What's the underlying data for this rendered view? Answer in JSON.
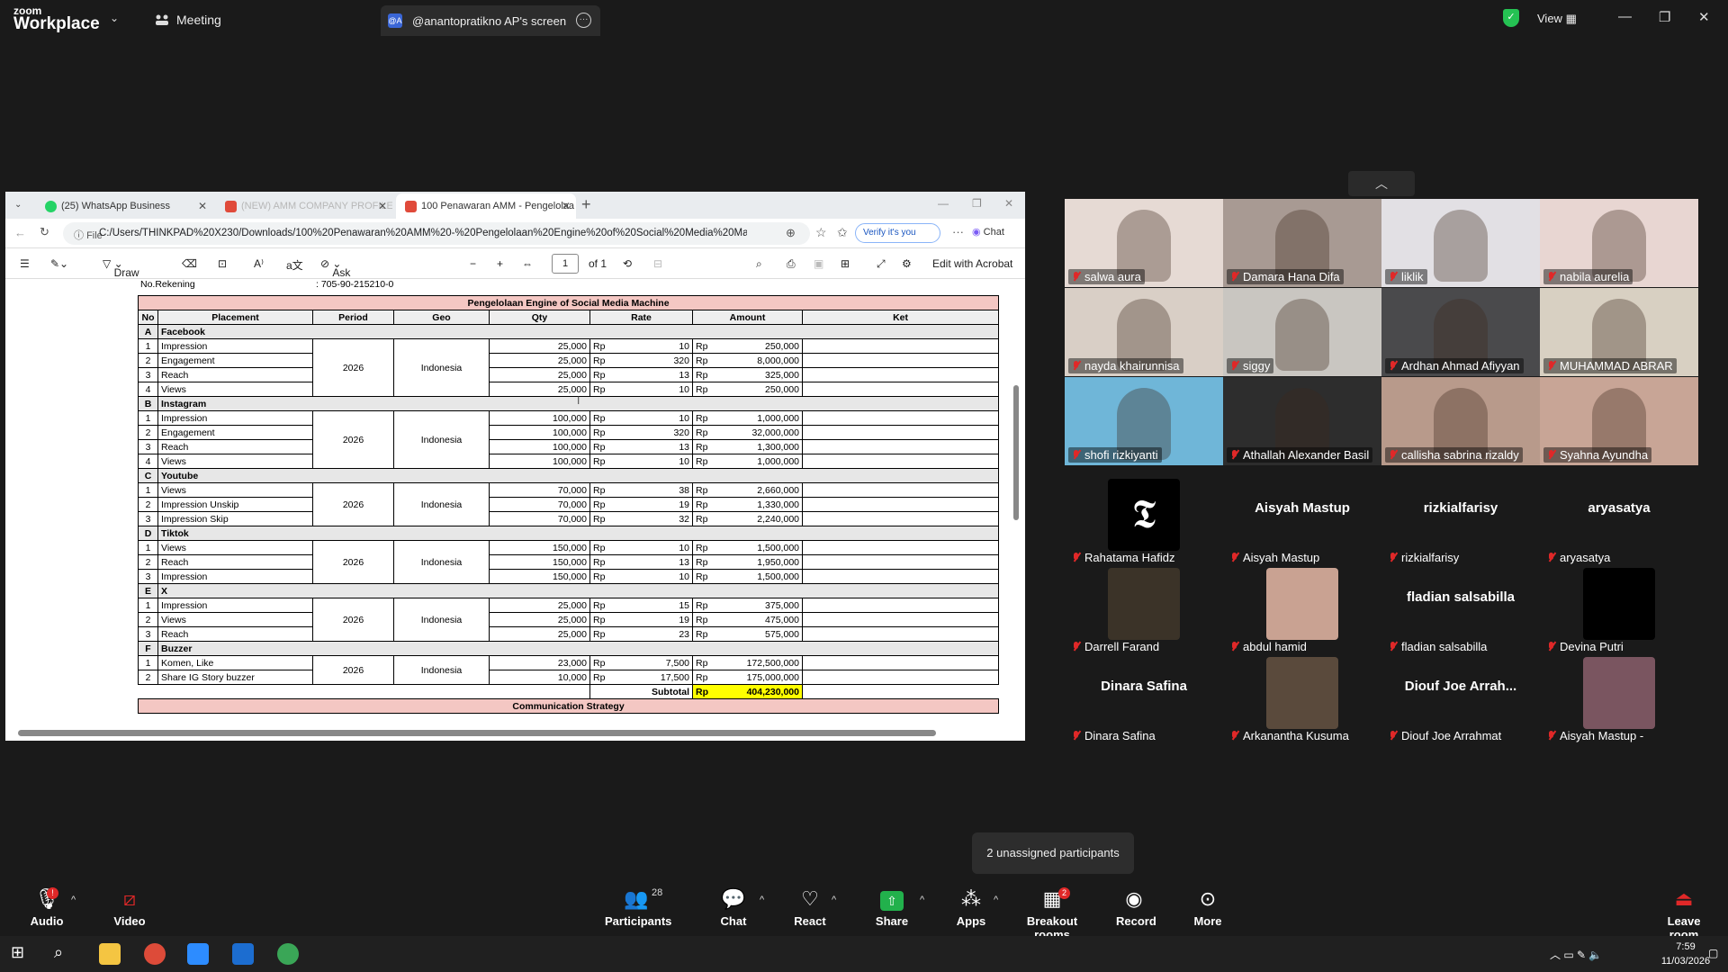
{
  "zoom": {
    "logo_top": "zoom",
    "logo_bottom": "Workplace",
    "meeting_label": "Meeting",
    "screen_tab_avatar": "@A",
    "screen_tab_label": "@anantopratikno AP's screen",
    "view_label": "View",
    "unassigned": "2 unassigned participants",
    "toolbar": {
      "audio": "Audio",
      "video": "Video",
      "participants": "Participants",
      "participants_count": "28",
      "chat": "Chat",
      "react": "React",
      "share": "Share",
      "apps": "Apps",
      "breakout": "Breakout rooms",
      "breakout_badge": "2",
      "record": "Record",
      "more": "More",
      "leave": "Leave room"
    }
  },
  "browser": {
    "tabs": [
      {
        "label": "(25) WhatsApp Business",
        "color": "#25d366"
      },
      {
        "label": "(NEW) AMM COMPANY PROFILE.p",
        "color": "#e04a3a"
      },
      {
        "label": "100 Penawaran AMM - Pengelolaa",
        "color": "#e04a3a"
      }
    ],
    "url_prefix": "File",
    "url": "C:/Users/THINKPAD%20X230/Downloads/100%20Penawaran%20AMM%20-%20Pengelolaan%20Engine%20of%20Social%20Media%20Machine...",
    "verify": "Verify it's you",
    "chat": "Chat",
    "pdf": {
      "draw": "Draw",
      "ask": "Ask Copilot",
      "page": "1",
      "of": "of 1",
      "edit": "Edit with Acrobat"
    }
  },
  "document": {
    "rekening_label": "No.Rekening",
    "rekening_value": ": 705-90-215210-0",
    "title": "Pengelolaan Engine of Social Media Machine",
    "headers": [
      "No",
      "Placement",
      "Period",
      "Geo",
      "Qty",
      "Rate",
      "Amount",
      "Ket"
    ],
    "groups": [
      {
        "code": "A",
        "name": "Facebook",
        "period": "2026",
        "geo": "Indonesia",
        "rows": [
          {
            "no": "1",
            "item": "Impression",
            "qty": "25,000",
            "cur": "Rp",
            "rate": "10",
            "acur": "Rp",
            "amount": "250,000"
          },
          {
            "no": "2",
            "item": "Engagement",
            "qty": "25,000",
            "cur": "Rp",
            "rate": "320",
            "acur": "Rp",
            "amount": "8,000,000"
          },
          {
            "no": "3",
            "item": "Reach",
            "qty": "25,000",
            "cur": "Rp",
            "rate": "13",
            "acur": "Rp",
            "amount": "325,000"
          },
          {
            "no": "4",
            "item": "Views",
            "qty": "25,000",
            "cur": "Rp",
            "rate": "10",
            "acur": "Rp",
            "amount": "250,000"
          }
        ]
      },
      {
        "code": "B",
        "name": "Instagram",
        "period": "2026",
        "geo": "Indonesia",
        "rows": [
          {
            "no": "1",
            "item": "Impression",
            "qty": "100,000",
            "cur": "Rp",
            "rate": "10",
            "acur": "Rp",
            "amount": "1,000,000"
          },
          {
            "no": "2",
            "item": "Engagement",
            "qty": "100,000",
            "cur": "Rp",
            "rate": "320",
            "acur": "Rp",
            "amount": "32,000,000"
          },
          {
            "no": "3",
            "item": "Reach",
            "qty": "100,000",
            "cur": "Rp",
            "rate": "13",
            "acur": "Rp",
            "amount": "1,300,000"
          },
          {
            "no": "4",
            "item": "Views",
            "qty": "100,000",
            "cur": "Rp",
            "rate": "10",
            "acur": "Rp",
            "amount": "1,000,000"
          }
        ]
      },
      {
        "code": "C",
        "name": "Youtube",
        "period": "2026",
        "geo": "Indonesia",
        "rows": [
          {
            "no": "1",
            "item": "Views",
            "qty": "70,000",
            "cur": "Rp",
            "rate": "38",
            "acur": "Rp",
            "amount": "2,660,000"
          },
          {
            "no": "2",
            "item": "Impression Unskip",
            "qty": "70,000",
            "cur": "Rp",
            "rate": "19",
            "acur": "Rp",
            "amount": "1,330,000"
          },
          {
            "no": "3",
            "item": "Impression Skip",
            "qty": "70,000",
            "cur": "Rp",
            "rate": "32",
            "acur": "Rp",
            "amount": "2,240,000"
          }
        ]
      },
      {
        "code": "D",
        "name": "Tiktok",
        "period": "2026",
        "geo": "Indonesia",
        "rows": [
          {
            "no": "1",
            "item": "Views",
            "qty": "150,000",
            "cur": "Rp",
            "rate": "10",
            "acur": "Rp",
            "amount": "1,500,000"
          },
          {
            "no": "2",
            "item": "Reach",
            "qty": "150,000",
            "cur": "Rp",
            "rate": "13",
            "acur": "Rp",
            "amount": "1,950,000"
          },
          {
            "no": "3",
            "item": "Impression",
            "qty": "150,000",
            "cur": "Rp",
            "rate": "10",
            "acur": "Rp",
            "amount": "1,500,000"
          }
        ]
      },
      {
        "code": "E",
        "name": "X",
        "period": "2026",
        "geo": "Indonesia",
        "rows": [
          {
            "no": "1",
            "item": "Impression",
            "qty": "25,000",
            "cur": "Rp",
            "rate": "15",
            "acur": "Rp",
            "amount": "375,000"
          },
          {
            "no": "2",
            "item": "Views",
            "qty": "25,000",
            "cur": "Rp",
            "rate": "19",
            "acur": "Rp",
            "amount": "475,000"
          },
          {
            "no": "3",
            "item": "Reach",
            "qty": "25,000",
            "cur": "Rp",
            "rate": "23",
            "acur": "Rp",
            "amount": "575,000"
          }
        ]
      },
      {
        "code": "F",
        "name": "Buzzer",
        "period": "2026",
        "geo": "Indonesia",
        "rows": [
          {
            "no": "1",
            "item": "Komen, Like",
            "qty": "23,000",
            "cur": "Rp",
            "rate": "7,500",
            "acur": "Rp",
            "amount": "172,500,000"
          },
          {
            "no": "2",
            "item": "Share IG Story buzzer",
            "qty": "10,000",
            "cur": "Rp",
            "rate": "17,500",
            "acur": "Rp",
            "amount": "175,000,000"
          }
        ]
      }
    ],
    "subtotal_label": "Subtotal",
    "subtotal_cur": "Rp",
    "subtotal_value": "404,230,000",
    "next_section": "Communication Strategy"
  },
  "gallery": {
    "video_tiles": [
      {
        "name": "salwa aura",
        "bg": "#e6dad4"
      },
      {
        "name": "Damara Hana Difa",
        "bg": "#a89a93"
      },
      {
        "name": "liklik",
        "bg": "#e2e0e4"
      },
      {
        "name": "nabila aurelia",
        "bg": "#e8d6d2"
      },
      {
        "name": "nayda khairunnisa",
        "bg": "#d9cfc6"
      },
      {
        "name": "siggy",
        "bg": "#c9c6c1"
      },
      {
        "name": "Ardhan Ahmad Afiyyan",
        "bg": "#4a4a4c"
      },
      {
        "name": "MUHAMMAD ABRAR",
        "bg": "#d8d0c2"
      },
      {
        "name": "shofi rizkiyanti",
        "bg": "#6fb6d8"
      },
      {
        "name": "Athallah Alexander Basil",
        "bg": "#2d2d2d"
      },
      {
        "name": "callisha sabrina rizaldy",
        "bg": "#b89a8b"
      },
      {
        "name": "Syahna Ayundha",
        "bg": "#c8a596"
      }
    ],
    "name_tiles": [
      {
        "big": "",
        "name": "Rahatama Hafidz",
        "thumb": "#000000",
        "glyph": "𝕿"
      },
      {
        "big": "Aisyah Mastup",
        "name": "Aisyah Mastup",
        "thumb": "",
        "glyph": ""
      },
      {
        "big": "rizkialfarisy",
        "name": "rizkialfarisy",
        "thumb": "",
        "glyph": ""
      },
      {
        "big": "aryasatya",
        "name": "aryasatya",
        "thumb": "",
        "glyph": ""
      },
      {
        "big": "",
        "name": "Darrell Farand",
        "thumb": "#3b3328",
        "glyph": ""
      },
      {
        "big": "",
        "name": "abdul hamid",
        "thumb": "#c9a292",
        "glyph": ""
      },
      {
        "big": "fladian salsabilla",
        "name": "fladian salsabilla",
        "thumb": "",
        "glyph": ""
      },
      {
        "big": "",
        "name": "Devina Putri",
        "thumb": "#000000",
        "glyph": ""
      },
      {
        "big": "Dinara Safina",
        "name": "Dinara Safina",
        "thumb": "",
        "glyph": ""
      },
      {
        "big": "",
        "name": "Arkanantha Kusuma",
        "thumb": "#5a4a3c",
        "glyph": ""
      },
      {
        "big": "Diouf Joe Arrah...",
        "name": "Diouf Joe Arrahmat",
        "thumb": "",
        "glyph": ""
      },
      {
        "big": "",
        "name": "Aisyah Mastup -",
        "thumb": "#7a5560",
        "glyph": ""
      }
    ]
  },
  "taskbar": {
    "time": "7:59",
    "date": "11/03/2026"
  }
}
